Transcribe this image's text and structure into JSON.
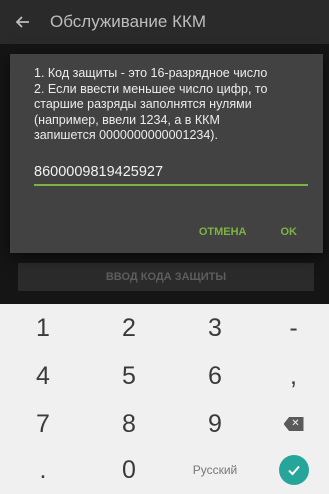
{
  "appbar": {
    "title": "Обслуживание ККМ",
    "back_icon": "arrow-back-icon"
  },
  "dialog": {
    "message_lines": [
      "1. Код защиты - это 16-разрядное число",
      "2. Если ввести меньшее число цифр, то",
      "старшие разряды заполнятся нулями",
      "(например, ввели 1234, а в ККМ",
      "запишется 0000000000001234)."
    ],
    "code_value": "8600009819425927",
    "cancel_label": "ОТМЕНА",
    "ok_label": "OK",
    "accent_color": "#7cb342"
  },
  "background_button": {
    "label": "ВВОД КОДА ЗАЩИТЫ"
  },
  "keyboard": {
    "rows": [
      [
        "1",
        "2",
        "3",
        "-"
      ],
      [
        "4",
        "5",
        "6",
        ","
      ],
      [
        "7",
        "8",
        "9",
        "backspace-icon"
      ],
      [
        ".",
        "0",
        "Русский",
        "enter-check-icon"
      ]
    ],
    "enter_color": "#26a69a"
  }
}
